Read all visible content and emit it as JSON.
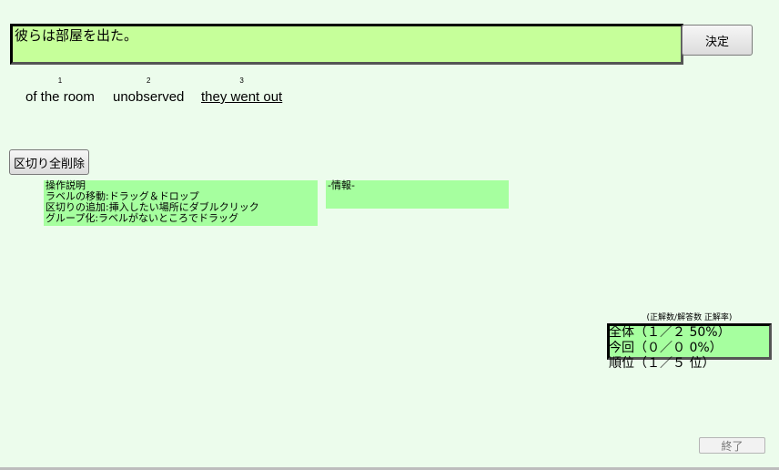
{
  "answer": {
    "text": "彼らは部屋を出た。"
  },
  "buttons": {
    "decide": "決定",
    "clear_separators": "区切り全削除",
    "exit": "終了"
  },
  "chunks": [
    {
      "number": "1",
      "text": "of the room",
      "underlined": false
    },
    {
      "number": "2",
      "text": "unobserved",
      "underlined": false
    },
    {
      "number": "3",
      "text": "they went out",
      "underlined": true
    }
  ],
  "help_panel": {
    "title": "操作説明",
    "lines": [
      "ラベルの移動:ドラッグ＆ドロップ",
      "区切りの追加:挿入したい場所にダブルクリック",
      "グループ化:ラベルがないところでドラッグ"
    ]
  },
  "info_panel": {
    "title": "-情報-"
  },
  "stats": {
    "caption": "(正解数/解答数 正解率)",
    "total": "全体（１／２ 50%）",
    "current": "今回（０／０ 0%）",
    "rank": "順位（１／５ 位）"
  },
  "colors": {
    "background": "#ecfcec",
    "answer_box": "#c6ff9a",
    "panel": "#a6ff9f"
  }
}
